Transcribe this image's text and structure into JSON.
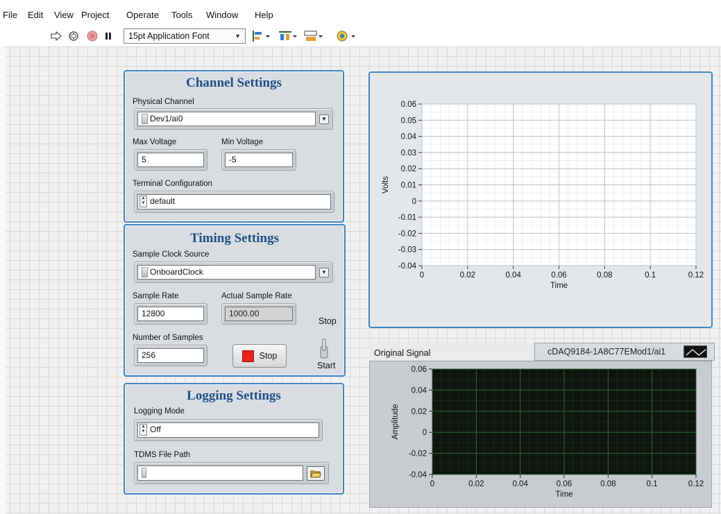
{
  "menu": [
    "File",
    "Edit",
    "View",
    "Project",
    "Operate",
    "Tools",
    "Window",
    "Help"
  ],
  "toolbar": {
    "font_select": "15pt Application Font",
    "icons": [
      "run-arrow-icon",
      "run-continuous-icon",
      "abort-icon",
      "pause-icon",
      "align-objects-icon",
      "distribute-objects-icon",
      "resize-objects-icon",
      "reorder-icon"
    ]
  },
  "channel_settings": {
    "title": "Channel Settings",
    "physical_channel_label": "Physical Channel",
    "physical_channel_value": "Dev1/ai0",
    "max_voltage_label": "Max Voltage",
    "max_voltage_value": "5",
    "min_voltage_label": "Min Voltage",
    "min_voltage_value": "-5",
    "terminal_config_label": "Terminal Configuration",
    "terminal_config_value": "default"
  },
  "timing_settings": {
    "title": "Timing Settings",
    "sample_clock_label": "Sample Clock Source",
    "sample_clock_value": "OnboardClock",
    "sample_rate_label": "Sample Rate",
    "sample_rate_value": "12800",
    "actual_rate_label": "Actual Sample Rate",
    "actual_rate_value": "1000.00",
    "num_samples_label": "Number of Samples",
    "num_samples_value": "256",
    "stop_button_label": "Stop",
    "toggle_top_label": "Stop",
    "toggle_bottom_label": "Start"
  },
  "logging_settings": {
    "title": "Logging Settings",
    "logging_mode_label": "Logging Mode",
    "logging_mode_value": "Off",
    "tdms_path_label": "TDMS File Path",
    "tdms_path_value": ""
  },
  "colors": {
    "panel_border": "#3e86c2",
    "title_text": "#1e4f86",
    "stop_led": "#e8211c",
    "dark_plot_bg": "#0f140f",
    "dark_plot_grid": "#2f6a2f"
  },
  "chart_data": [
    {
      "type": "line",
      "title": "",
      "xlabel": "Time",
      "ylabel": "Volts",
      "xlim": [
        0,
        0.12
      ],
      "ylim": [
        -0.04,
        0.06
      ],
      "x_ticks": [
        "0",
        "0.02",
        "0.04",
        "0.06",
        "0.08",
        "0.1",
        "0.12"
      ],
      "y_ticks": [
        "0.06",
        "0.05",
        "0.04",
        "0.03",
        "0.02",
        "0.01",
        "0",
        "-0.01",
        "-0.02",
        "-0.03",
        "-0.04"
      ],
      "grid": true,
      "series": []
    },
    {
      "type": "line",
      "title": "Original Signal",
      "xlabel": "Time",
      "ylabel": "Amplitude",
      "xlim": [
        0,
        0.12
      ],
      "ylim": [
        -0.04,
        0.06
      ],
      "x_ticks": [
        "0",
        "0.02",
        "0.04",
        "0.06",
        "0.08",
        "0.1",
        "0.12"
      ],
      "y_ticks": [
        "0.06",
        "0.04",
        "0.02",
        "0",
        "-0.02",
        "-0.04"
      ],
      "grid": true,
      "legend": "cDAQ9184-1A8C77EMod1/ai1",
      "series": []
    }
  ]
}
